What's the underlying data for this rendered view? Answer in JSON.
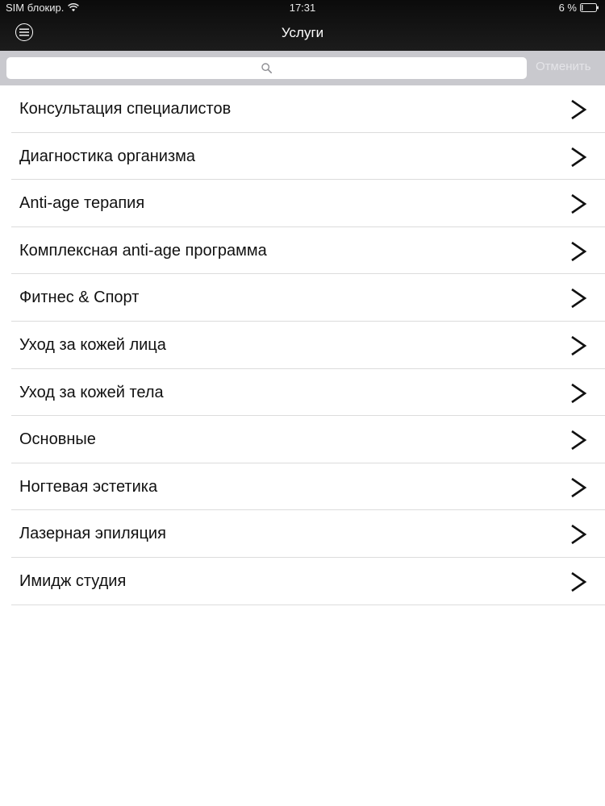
{
  "status_bar": {
    "carrier": "SIM блокир.",
    "time": "17:31",
    "battery": "6 %",
    "wifi_icon": "wifi-icon",
    "battery_icon": "battery-icon"
  },
  "nav": {
    "title": "Услуги",
    "menu_icon": "hamburger-menu-icon"
  },
  "search": {
    "placeholder": "",
    "value": "",
    "cancel_label": "Отменить",
    "icon": "search-icon"
  },
  "services": [
    {
      "label": "Консультация специалистов"
    },
    {
      "label": "Диагностика организма"
    },
    {
      "label": "Anti-age терапия"
    },
    {
      "label": "Комплексная anti-age программа"
    },
    {
      "label": "Фитнес & Спорт"
    },
    {
      "label": "Уход за кожей лица"
    },
    {
      "label": "Уход за кожей тела"
    },
    {
      "label": "Основные"
    },
    {
      "label": "Ногтевая эстетика"
    },
    {
      "label": "Лазерная эпиляция"
    },
    {
      "label": "Имидж студия"
    }
  ],
  "colors": {
    "navbar": "#111111",
    "searchbar": "#c9c9ce",
    "separator": "#dcdcdc",
    "text": "#111111"
  }
}
